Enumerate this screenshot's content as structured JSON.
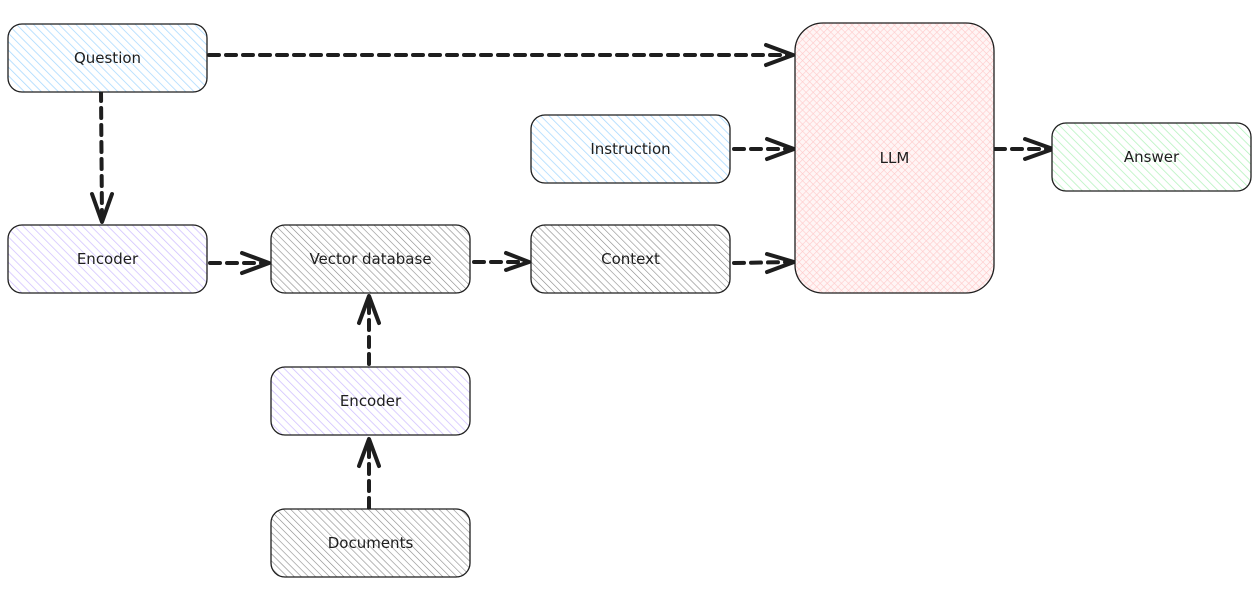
{
  "colors": {
    "blue": "#a5d8ff",
    "purple": "#d0bfff",
    "gray": "#868e96",
    "red": "#ffc9c9",
    "green": "#b2f2bb",
    "stroke": "#1e1e1e"
  },
  "nodes": {
    "question": "Question",
    "encoder_query": "Encoder",
    "vector_database": "Vector database",
    "instruction": "Instruction",
    "context": "Context",
    "llm": "LLM",
    "answer": "Answer",
    "encoder_docs": "Encoder",
    "documents": "Documents"
  },
  "edges": [
    [
      "Question",
      "LLM"
    ],
    [
      "Question",
      "Encoder"
    ],
    [
      "Encoder",
      "Vector database"
    ],
    [
      "Vector database",
      "Context"
    ],
    [
      "Instruction",
      "LLM"
    ],
    [
      "Context",
      "LLM"
    ],
    [
      "LLM",
      "Answer"
    ],
    [
      "Encoder (documents)",
      "Vector database"
    ],
    [
      "Documents",
      "Encoder (documents)"
    ]
  ]
}
